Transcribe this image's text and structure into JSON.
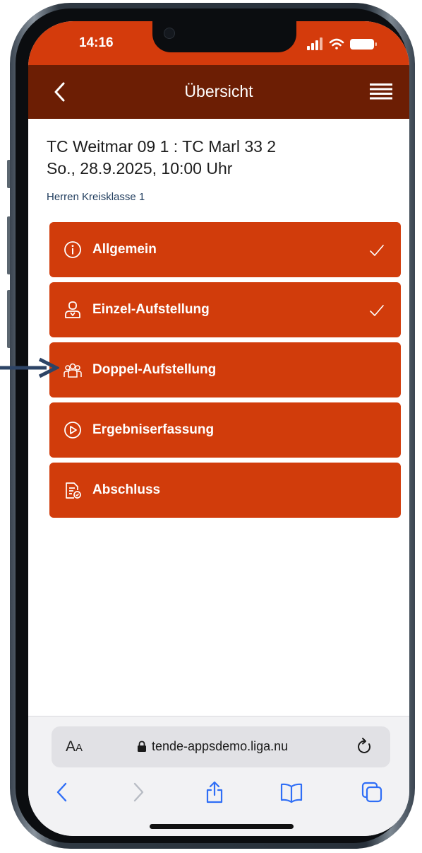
{
  "status_bar": {
    "time": "14:16",
    "icons": [
      "signal-icon",
      "wifi-icon",
      "battery-icon"
    ],
    "color": "#d43b0c"
  },
  "header": {
    "title": "Übersicht",
    "back_icon": "chevron-left-icon",
    "menu_icon": "hamburger-menu-icon",
    "color": "#6c1e04"
  },
  "match": {
    "title_line1": "TC Weitmar 09 1 : TC Marl 33 2",
    "title_line2": "So., 28.9.2025, 10:00 Uhr",
    "league": "Herren Kreisklasse 1"
  },
  "nav_items": [
    {
      "label": "Allgemein",
      "icon": "info-icon",
      "completed": true
    },
    {
      "label": "Einzel-Aufstellung",
      "icon": "single-player-icon",
      "completed": true
    },
    {
      "label": "Doppel-Aufstellung",
      "icon": "doubles-team-icon",
      "completed": false
    },
    {
      "label": "Ergebniserfassung",
      "icon": "play-circle-icon",
      "completed": false
    },
    {
      "label": "Abschluss",
      "icon": "document-check-icon",
      "completed": false
    }
  ],
  "accent_color": "#d13c0b",
  "browser": {
    "text_size_big": "A",
    "text_size_small": "A",
    "url": "tende-appsdemo.liga.nu",
    "toolbar": [
      "back-icon",
      "forward-icon",
      "share-icon",
      "bookmarks-icon",
      "tabs-icon"
    ]
  },
  "annotation": {
    "arrow_color": "#2d4466"
  }
}
